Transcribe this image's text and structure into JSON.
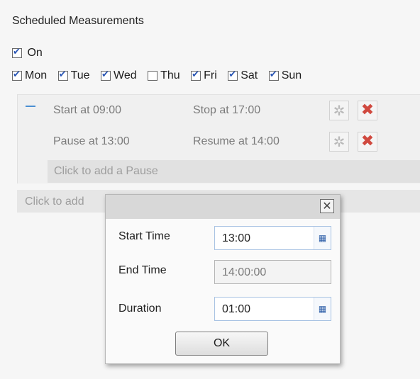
{
  "title": "Scheduled Measurements",
  "on": {
    "label": "On",
    "checked": true
  },
  "days": [
    {
      "label": "Mon",
      "checked": true
    },
    {
      "label": "Tue",
      "checked": true
    },
    {
      "label": "Wed",
      "checked": true
    },
    {
      "label": "Thu",
      "checked": false
    },
    {
      "label": "Fri",
      "checked": true
    },
    {
      "label": "Sat",
      "checked": true
    },
    {
      "label": "Sun",
      "checked": true
    }
  ],
  "schedule": {
    "start_text": "Start at 09:00",
    "stop_text": "Stop at 17:00",
    "pause_text": "Pause at 13:00",
    "resume_text": "Resume at 14:00",
    "add_pause": "Click to add a Pause",
    "add_schedule": "Click to add"
  },
  "dialog": {
    "close_glyph": "✕",
    "start_time_label": "Start Time",
    "start_time_value": "13:00",
    "end_time_label": "End Time",
    "end_time_value": "14:00:00",
    "duration_label": "Duration",
    "duration_value": "01:00",
    "ok_label": "OK"
  },
  "icons": {
    "gear": "✲",
    "delete": "✖",
    "calendar": "▦"
  }
}
